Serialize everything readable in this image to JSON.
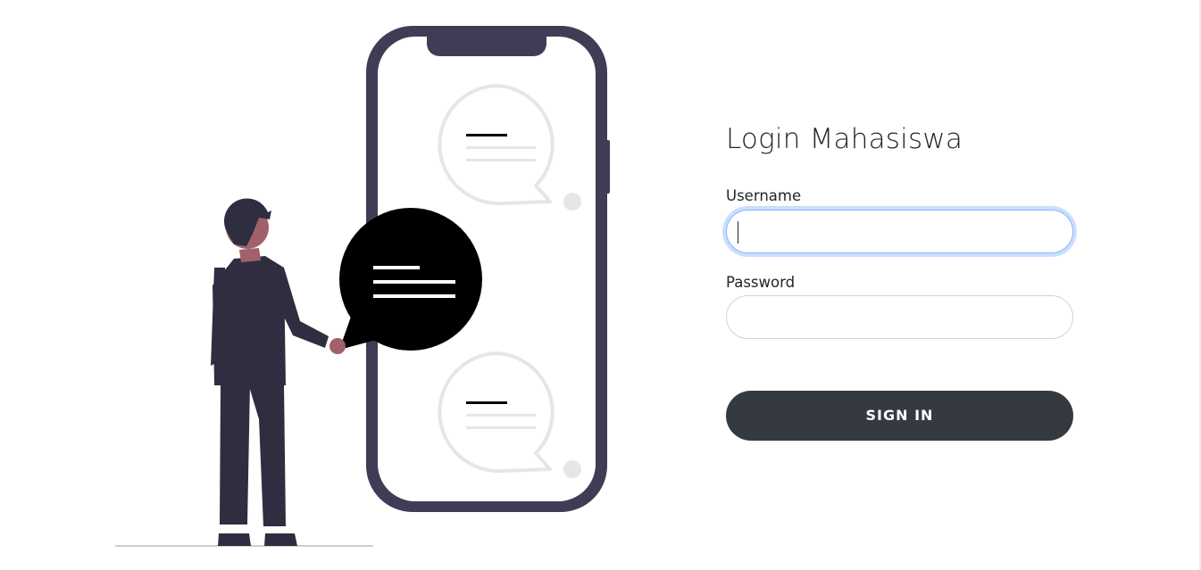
{
  "login_form": {
    "title": "Login Mahasiswa",
    "username_label": "Username",
    "username_value": "",
    "password_label": "Password",
    "password_value": "",
    "signin_label": "SIGN IN"
  },
  "illustration": {
    "icons": [
      "smartphone-icon",
      "speech-bubble-icon",
      "person-icon"
    ],
    "colors": {
      "phone_frame": "#3f3d56",
      "suit": "#2f2e41",
      "skin": "#a0616a",
      "hair": "#2f2e41",
      "bubble_active": "#000000",
      "bubble_inactive": "#e6e6e6",
      "ground": "#cccccc"
    }
  },
  "theme": {
    "button_color": "#343a40",
    "focus_border": "#86b7fe",
    "text_color": "#212529"
  }
}
